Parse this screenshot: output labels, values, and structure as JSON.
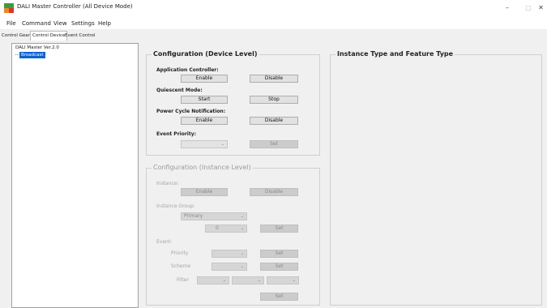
{
  "window": {
    "title": "DALI Master Controller (All Device Mode)",
    "minimize": "–",
    "maximize": "□",
    "close": "✕"
  },
  "menu": [
    "File",
    "Command",
    "View",
    "Settings",
    "Help"
  ],
  "tabs": [
    "Control Gear",
    "Control Device",
    "Event Control"
  ],
  "tree": {
    "root": "DALI Master Ver.2.0",
    "child": "Broadcast"
  },
  "device_level": {
    "title": "Configuration (Device Level)",
    "app_controller_label": "Application Controller:",
    "app_enable": "Enable",
    "app_disable": "Disable",
    "quiescent_label": "Quiescent Mode:",
    "quiescent_start": "Start",
    "quiescent_stop": "Stop",
    "power_cycle_label": "Power Cycle Notification:",
    "power_enable": "Enable",
    "power_disable": "Disable",
    "event_priority_label": "Event Priority:",
    "event_priority_value": "",
    "set": "Set"
  },
  "instance_level": {
    "title": "Configuration (Instance Level)",
    "instance_label": "Instance:",
    "instance_enable": "Enable",
    "instance_disable": "Disable",
    "group_label": "Instance Group:",
    "group_value": "Primary",
    "group_number": "0",
    "group_set": "Set",
    "event_label": "Event:",
    "priority_label": "Priority",
    "priority_set": "Set",
    "scheme_label": "Scheme",
    "scheme_set": "Set",
    "filter_label": "Filter",
    "final_set": "Set"
  },
  "feature_panel": {
    "title": "Instance Type and Feature Type"
  },
  "colors": {
    "selection": "#0a64d0",
    "icon_green": "#3c9c3c",
    "icon_orange": "#f08a1c"
  }
}
